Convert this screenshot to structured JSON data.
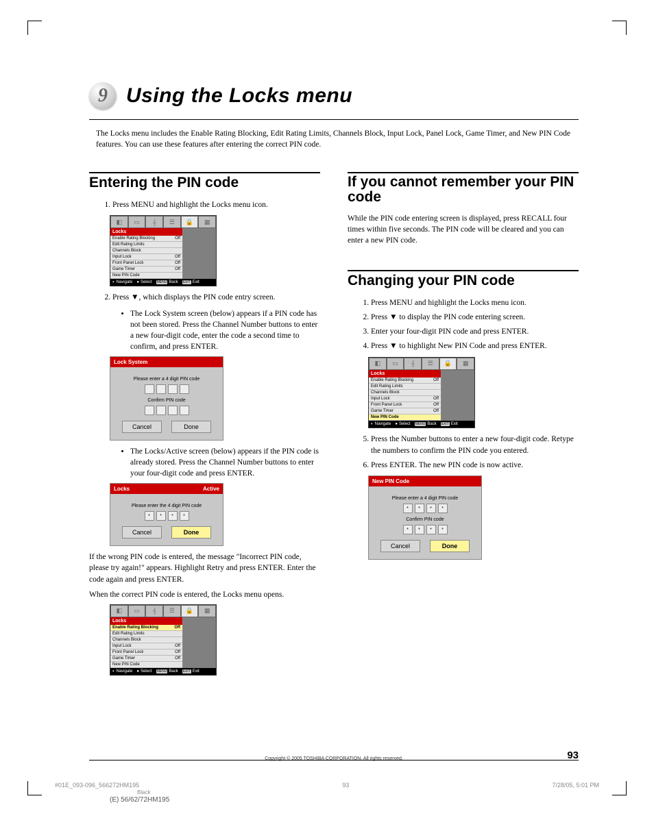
{
  "chapter": {
    "number": "9",
    "title": "Using the Locks menu"
  },
  "intro": "The Locks menu includes the Enable Rating Blocking, Edit Rating Limits, Channels Block, Input Lock, Panel Lock, Game Timer, and New PIN Code features. You can use these features after entering the correct PIN code.",
  "section_enter": {
    "title": "Entering the PIN code",
    "step1": "Press MENU and highlight the Locks menu icon.",
    "step2_pre": "Press ",
    "step2_post": ", which displays the PIN code entry screen.",
    "bullet1": "The Lock System screen (below) appears if a PIN code has not been stored. Press the Channel Number buttons to enter a new four-digit code, enter the code a second time to confirm, and press ENTER.",
    "bullet2": "The Locks/Active screen (below) appears if the PIN code is already stored. Press the Channel Number buttons to enter your four-digit code and press ENTER.",
    "wrongpin": "If the wrong PIN code is entered, the message \"Incorrect PIN code, please try again!\" appears. Highlight Retry and press ENTER. Enter the code again and press ENTER.",
    "correctpin": "When the correct PIN code is entered, the Locks menu opens."
  },
  "section_forgot": {
    "title": "If you cannot remember your PIN code",
    "body": "While the PIN code entering screen is displayed, press RECALL four times within five seconds. The PIN code will be cleared and you can enter a new PIN code."
  },
  "section_change": {
    "title": "Changing your PIN code",
    "step1": "Press MENU and highlight the Locks menu icon.",
    "step2_pre": "Press ",
    "step2_post": " to display the PIN code entering screen.",
    "step3": "Enter your four-digit PIN code and press ENTER.",
    "step4_pre": "Press ",
    "step4_post": " to highlight New PIN Code and press ENTER.",
    "step5": "Press the Number buttons to enter a new four-digit code. Retype the numbers to confirm the PIN code you entered.",
    "step6": "Press ENTER. The new PIN code is now active."
  },
  "menu": {
    "header": "Locks",
    "rows": [
      {
        "label": "Enable Rating Blocking",
        "val": "Off"
      },
      {
        "label": "Edit Rating Limits",
        "val": ""
      },
      {
        "label": "Channels Block",
        "val": ""
      },
      {
        "label": "Input Lock",
        "val": "Off"
      },
      {
        "label": "Front Panel Lock",
        "val": "Off"
      },
      {
        "label": "Game Timer",
        "val": "Off"
      },
      {
        "label": "New PIN Code",
        "val": ""
      }
    ],
    "help": {
      "nav": "Navigate",
      "sel": "Select",
      "menu": "MENU",
      "back": "Back",
      "exit": "EXIT",
      "exitlbl": "Exit"
    }
  },
  "lock_system": {
    "title": "Lock System",
    "prompt": "Please enter a 4 digit PIN code",
    "confirm": "Confirm PIN code",
    "cancel": "Cancel",
    "done": "Done"
  },
  "locks_active": {
    "title": "Locks",
    "right": "Active",
    "prompt": "Please enter the 4 digit PIN code",
    "cancel": "Cancel",
    "done": "Done",
    "star": "*"
  },
  "newpin": {
    "title": "New PIN Code",
    "prompt": "Please enter a 4 digit PIN code",
    "confirm": "Confirm PIN code",
    "cancel": "Cancel",
    "done": "Done",
    "star": "*"
  },
  "footer": {
    "copy": "Copyright © 2005 TOSHIBA CORPORATION. All rights reserved.",
    "page": "93",
    "fileref": "#01E_093-096_566272HM195",
    "centerpage": "93",
    "date": "7/28/05, 5:01 PM",
    "black": "Black",
    "model": "(E) 56/62/72HM195"
  }
}
